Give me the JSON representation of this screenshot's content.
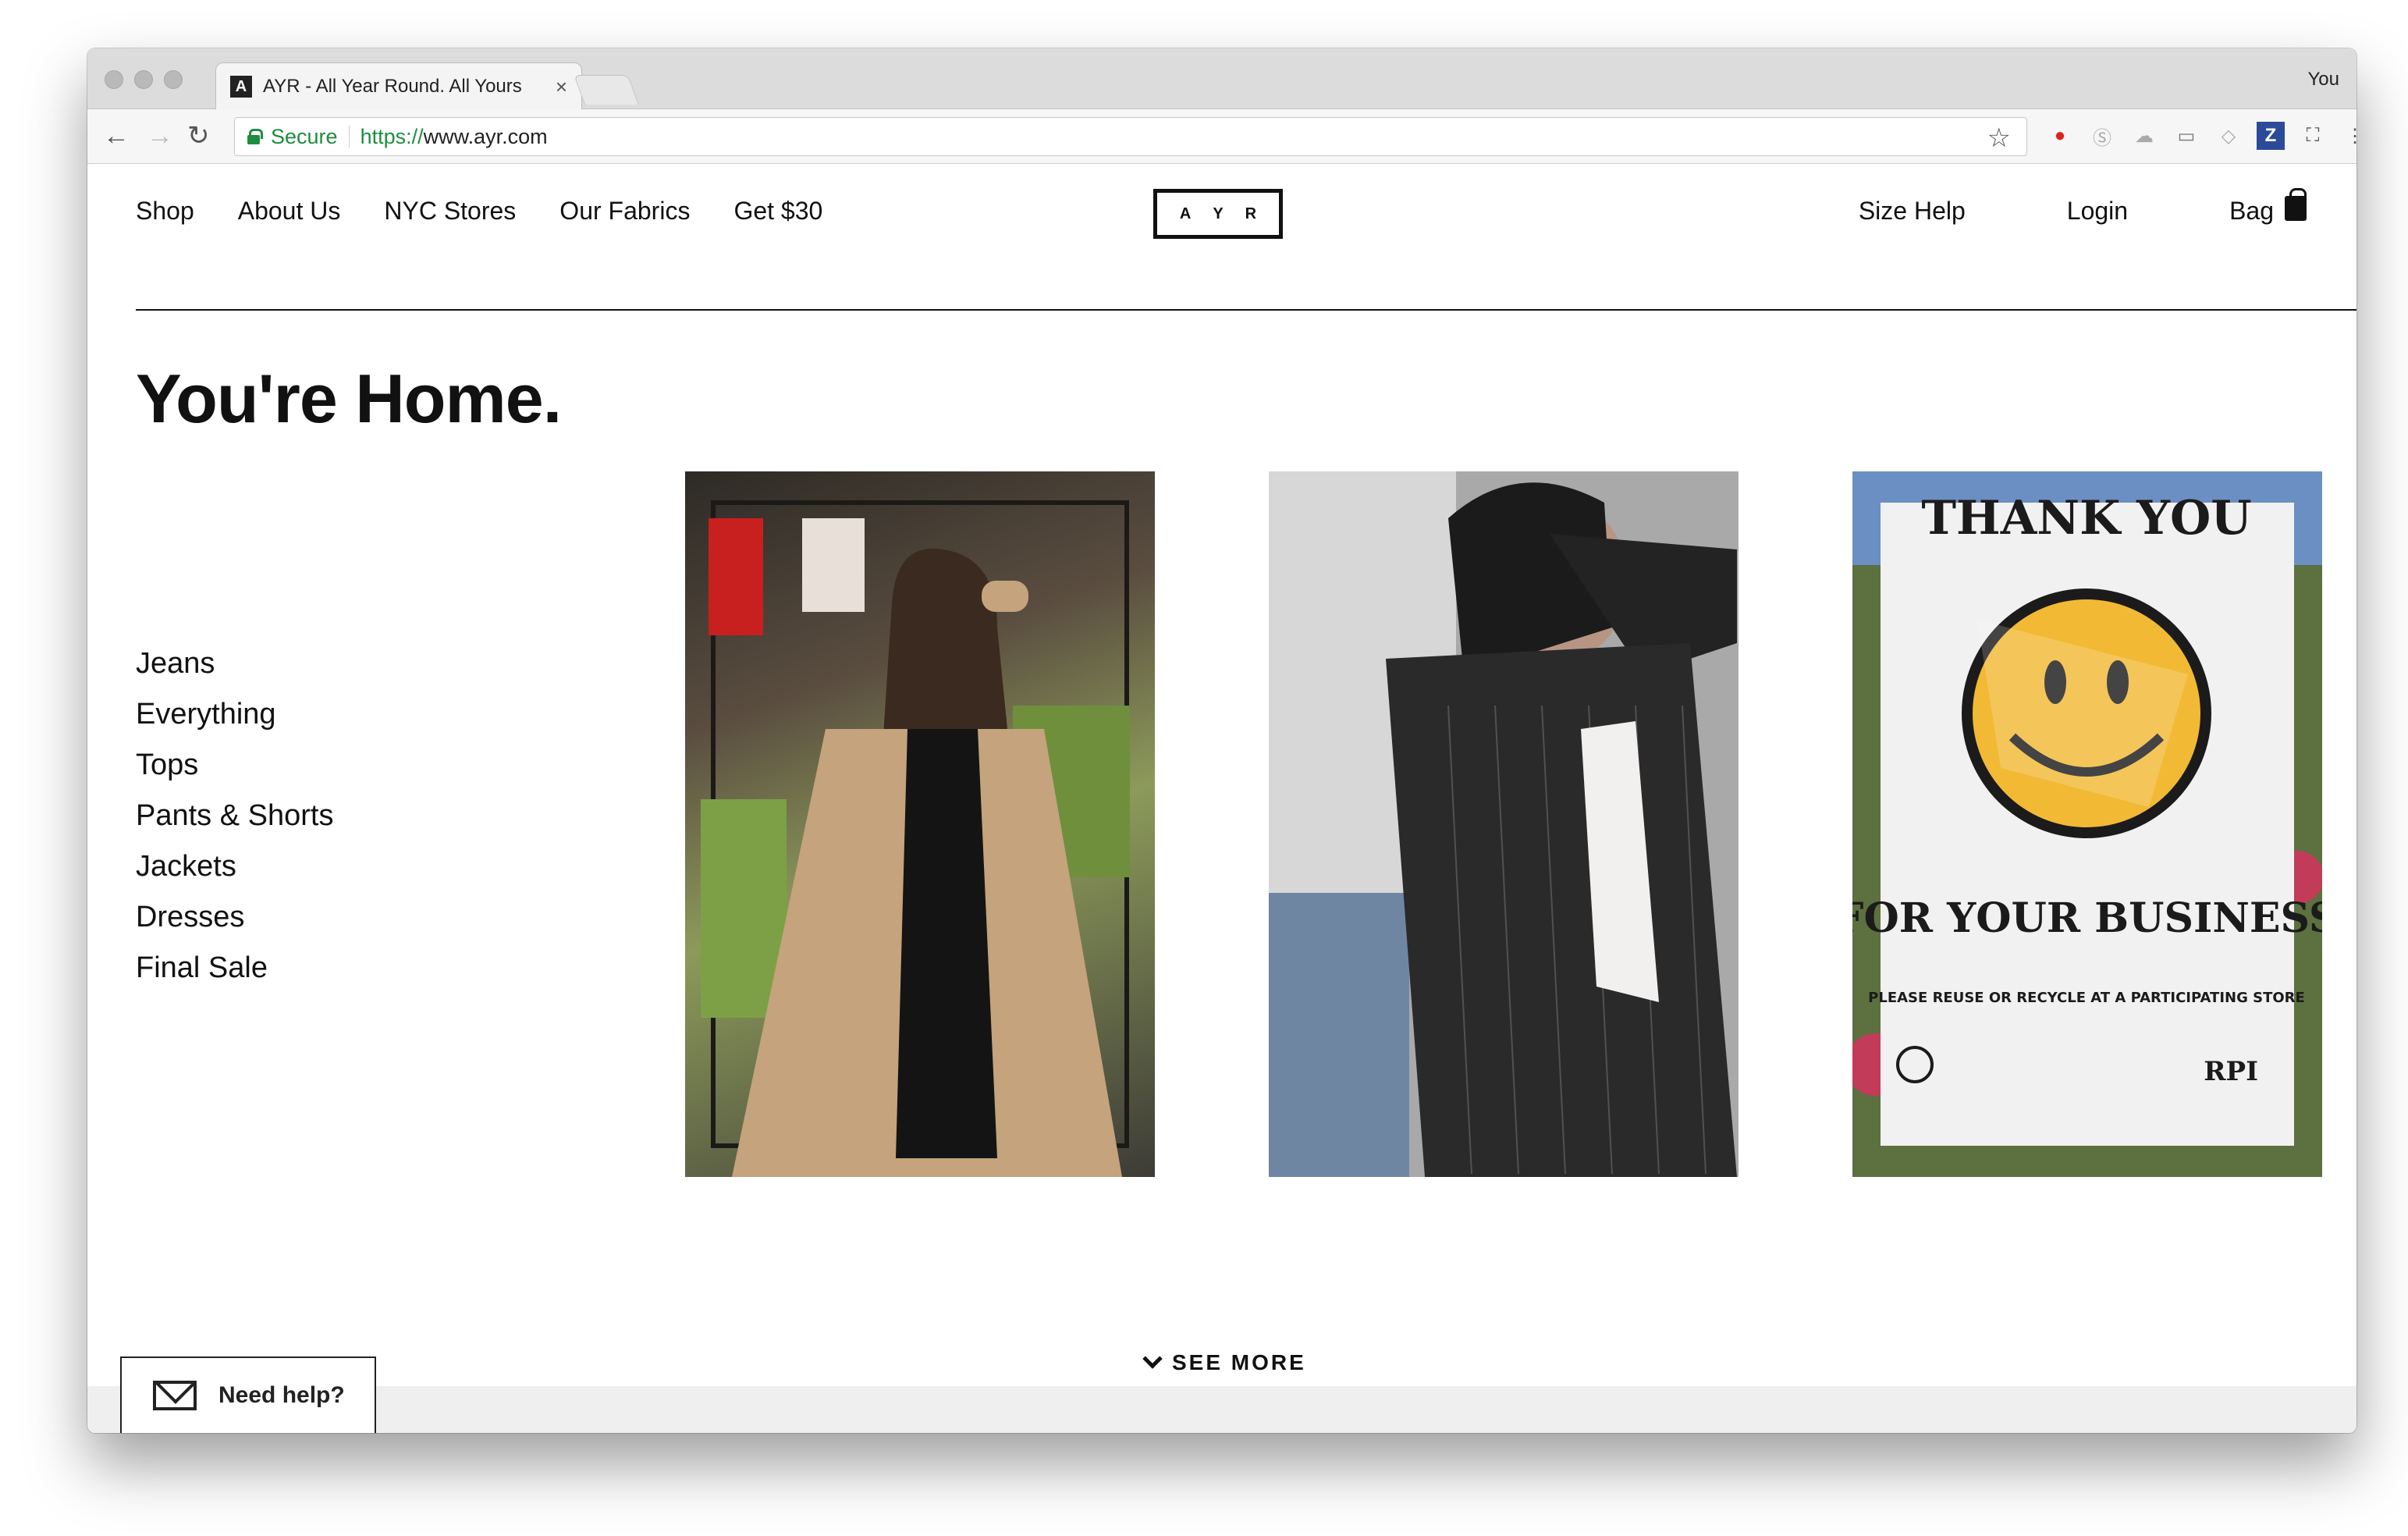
{
  "browser": {
    "tab_title": "AYR - All Year Round. All Yours",
    "tab_close": "×",
    "profile": "You",
    "secure_label": "Secure",
    "url_scheme": "https://",
    "url_host": "www.ayr.com"
  },
  "nav": {
    "left": [
      "Shop",
      "About Us",
      "NYC Stores",
      "Our Fabrics",
      "Get $30"
    ],
    "logo_letters": [
      "A",
      "Y",
      "R"
    ],
    "size_help": "Size Help",
    "login": "Login",
    "bag": "Bag"
  },
  "headline": "You're Home.",
  "categories": [
    "Jeans",
    "Everything",
    "Tops",
    "Pants & Shorts",
    "Jackets",
    "Dresses",
    "Final Sale"
  ],
  "photos": [
    {
      "name": "woman-camel-coat-market-photo"
    },
    {
      "name": "woman-pinstripe-blazer-street-photo"
    },
    {
      "name": "thank-you-smiley-bag-photo",
      "overlay_top": "THANK YOU",
      "overlay_bottom": "FOR YOUR BUSINESS",
      "overlay_small": "PLEASE REUSE OR RECYCLE AT A PARTICIPATING STORE",
      "brand": "RPI"
    }
  ],
  "see_more": "SEE MORE",
  "help": "Need help?"
}
